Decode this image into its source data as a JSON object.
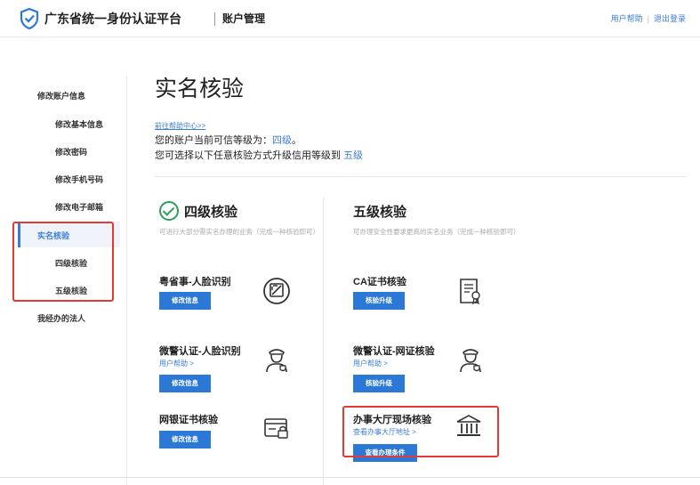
{
  "header": {
    "site_title": "广东省统一身份认证平台",
    "section": "账户管理",
    "links": [
      "用户帮助",
      "退出登录"
    ]
  },
  "sidebar": {
    "items": [
      {
        "label": "修改账户信息"
      },
      {
        "label": "修改基本信息"
      },
      {
        "label": "修改密码"
      },
      {
        "label": "修改手机号码"
      },
      {
        "label": "修改电子邮箱"
      },
      {
        "label": "实名核验",
        "active": true
      },
      {
        "label": "四级核验"
      },
      {
        "label": "五级核验"
      },
      {
        "label": "我经办的法人"
      }
    ]
  },
  "main": {
    "heading": "实名核验",
    "help_link": "前往帮助中心>>",
    "trust_prefix": "您的账户当前可信等级为：",
    "trust_level": "四级",
    "trust_suffix": "。",
    "upgrade_prefix": "您可选择以下任意核验方式升级信用等级到",
    "upgrade_level": "五级",
    "level4": {
      "title": "四级核验",
      "desc": "可进行大部分需实名办理的业务（完成一种核验即可）",
      "items": [
        {
          "title": "粤省事-人脸识别",
          "button": "修改信息",
          "icon": "face-scan-icon"
        },
        {
          "title": "微警认证-人脸识别",
          "link": "用户帮助 >",
          "button": "修改信息",
          "icon": "police-officer-icon"
        },
        {
          "title": "网银证书核验",
          "button": "修改信息",
          "icon": "bank-card-icon"
        }
      ]
    },
    "level5": {
      "title": "五级核验",
      "desc": "可办理安全性要求更高的实名业务（完成一种核验即可）",
      "items": [
        {
          "title": "CA证书核验",
          "button": "核验升级",
          "icon": "certificate-icon"
        },
        {
          "title": "微警认证-网证核验",
          "link": "用户帮助 >",
          "button": "核验升级",
          "icon": "police-officer-icon"
        },
        {
          "title": "办事大厅现场核验",
          "link": "查看办事大厅地址 >",
          "button": "查看办理条件",
          "icon": "government-building-icon"
        }
      ]
    }
  },
  "colors": {
    "accent": "#2b78d6",
    "link": "#3b7dd8",
    "highlight_box": "#e53935",
    "check": "#2e9e5b"
  }
}
